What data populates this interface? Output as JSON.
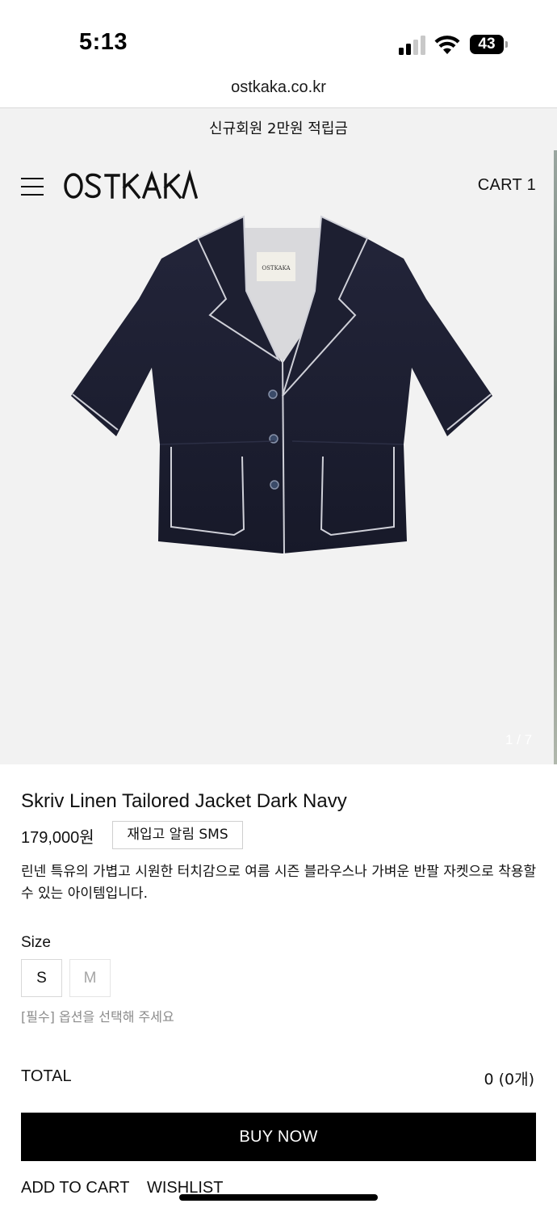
{
  "status_bar": {
    "time": "5:13",
    "battery_level": "43",
    "icons": [
      "signal-icon",
      "wifi-icon",
      "battery-icon"
    ]
  },
  "browser": {
    "url": "ostkaka.co.kr"
  },
  "promo_banner": {
    "text": "신규회원 2만원 적립금"
  },
  "header": {
    "brand": "OSTKAKA",
    "cart_label": "CART 1",
    "menu_icon": "hamburger-menu-icon"
  },
  "gallery": {
    "counter": "1 / 7",
    "label_on_garment": "OSTKAKA"
  },
  "product": {
    "name": "Skriv Linen Tailored Jacket Dark Navy",
    "price": "179,000원",
    "restock_button": "재입고 알림 SMS",
    "description": "린넨 특유의 가볍고 시원한 터치감으로 여름 시즌 블라우스나 가벼운 반팔 자켓으로 착용할 수 있는 아이템입니다."
  },
  "options": {
    "size_label": "Size",
    "sizes": [
      {
        "label": "S",
        "available": true
      },
      {
        "label": "M",
        "available": false
      }
    ],
    "required_note": "[필수] 옵션을 선택해 주세요"
  },
  "summary": {
    "total_label": "TOTAL",
    "total_value": "0 (0개)"
  },
  "actions": {
    "buy_now": "BUY NOW",
    "add_to_cart": "ADD TO CART",
    "wishlist": "WISHLIST"
  },
  "colors": {
    "banner_bg": "#f2f2f2",
    "buy_button_bg": "#000000",
    "text": "#111111",
    "muted_text": "#8b8b8b"
  }
}
